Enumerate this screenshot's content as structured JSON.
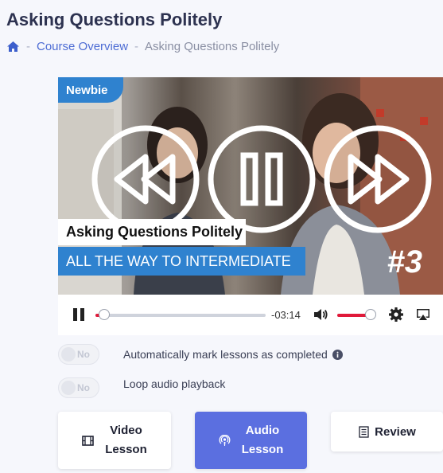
{
  "page": {
    "title": "Asking Questions Politely"
  },
  "breadcrumb": {
    "home_icon": "home-icon",
    "separator": "-",
    "course_overview": "Course Overview",
    "current": "Asking Questions Politely"
  },
  "video": {
    "badge": "Newbie",
    "caption": "Asking Questions Politely",
    "subcaption": "ALL THE WAY TO INTERMEDIATE",
    "episode": "#3",
    "overlay_controls": [
      "rewind-icon",
      "pause-icon",
      "fast-forward-icon"
    ]
  },
  "controls": {
    "play_state": "pause-icon",
    "progress": 0.05,
    "time_remaining": "-03:14",
    "volume": 0.8,
    "icons": [
      "volume-icon",
      "settings-icon",
      "airplay-icon"
    ],
    "accent_color": "#e01a3a"
  },
  "options": {
    "auto_mark": {
      "toggle": "No",
      "label": "Automatically mark lessons as completed"
    },
    "loop": {
      "toggle": "No",
      "label": "Loop audio playback"
    }
  },
  "buttons": {
    "video_line1": "Video",
    "video_line2": "Lesson",
    "audio_line1": "Audio",
    "audio_line2": "Lesson",
    "review": "Review",
    "active_color": "#5b6fe0"
  }
}
